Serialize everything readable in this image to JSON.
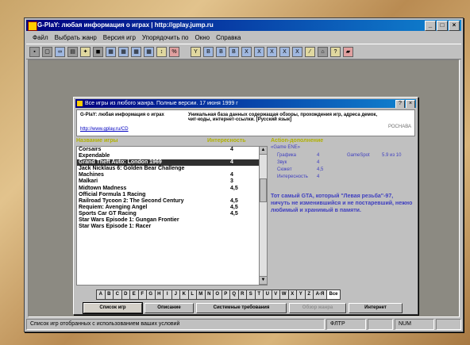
{
  "window": {
    "title": "G-PlaY: любая информация о играх | http://gplay.jump.ru",
    "controls": [
      "_",
      "□",
      "×"
    ]
  },
  "menu": [
    "Файл",
    "Выбрать жанр",
    "Версия игр",
    "Упорядочить по",
    "Окно",
    "Справка"
  ],
  "toolbar_icons": [
    "new-icon",
    "open-icon",
    "binoculars-icon",
    "print-icon",
    "tools-icon",
    "disk-icon",
    "grid-icon",
    "grid-icon",
    "grid-icon",
    "grid-icon",
    "sort-az-icon",
    "sort-icon",
    "filter-icon",
    "filter-icon",
    "filter-icon",
    "filter-icon",
    "filter-icon",
    "filter-icon",
    "filter-icon",
    "filter-icon",
    "filter-icon",
    "chart-icon",
    "home-icon",
    "help-icon",
    "book-icon"
  ],
  "dialog": {
    "title": "Все игры из любого жанра. Полные версии. 17 июня 1999 г",
    "controls": [
      "?",
      "×"
    ],
    "header_left": "G-PlaY: любая информация о играх",
    "header_right": "Уникальная база данных содержащая обзоры, прохождения игр, адреса демок, чит-коды, интернет-ссылки. [Русский язык]",
    "header_link": "http://www.gplay.ru/CD",
    "header_note": "РОСНАВА",
    "list_header_name": "Название игры",
    "list_header_rating": "Интересность",
    "games": [
      {
        "name": "Corsairs",
        "rating": "4"
      },
      {
        "name": "Expendable",
        "rating": ""
      },
      {
        "name": "Grand Theft Auto: London 1969",
        "rating": "4",
        "selected": true
      },
      {
        "name": "Jack Nicklaus 6: Golden Bear Challenge",
        "rating": ""
      },
      {
        "name": "Machines",
        "rating": "4"
      },
      {
        "name": "Malkari",
        "rating": "3"
      },
      {
        "name": "Midtown Madness",
        "rating": "4,5"
      },
      {
        "name": "Official Formula 1 Racing",
        "rating": ""
      },
      {
        "name": "Railroad Tycoon 2: The Second Century",
        "rating": "4,5"
      },
      {
        "name": "Requiem: Avenging Angel",
        "rating": "4,5"
      },
      {
        "name": "Sports Car GT Racing",
        "rating": "4,5"
      },
      {
        "name": "Star Wars Episode 1: Gungan Frontier",
        "rating": ""
      },
      {
        "name": "Star Wars Episode 1: Racer",
        "rating": ""
      }
    ],
    "info_header": "Action-дополнение",
    "info_sub": "«Game ENE»",
    "stats": {
      "graphics_label": "Графика",
      "graphics_value": "4",
      "sound_label": "Звук",
      "sound_value": "4",
      "plot_label": "Сюжет",
      "plot_value": "4,5",
      "interest_label": "Интересность",
      "interest_value": "4",
      "gamespot_label": "GameSpot",
      "gamespot_value": "5.9 из 10"
    },
    "description": "Тот самый GTA, который \"Левая резьба\"-97, ничуть не изменившийся и не постаревший, нежно любимый и хранимый в памяти.",
    "alphabet": [
      "A",
      "B",
      "C",
      "D",
      "E",
      "F",
      "G",
      "H",
      "I",
      "J",
      "K",
      "L",
      "M",
      "N",
      "O",
      "P",
      "Q",
      "R",
      "S",
      "T",
      "U",
      "V",
      "W",
      "X",
      "Y",
      "Z",
      "A-Я",
      "Все"
    ],
    "buttons": [
      "Список игр",
      "Описание",
      "Системные требования",
      "Обзор жанра",
      "Интернет"
    ]
  },
  "status": {
    "text": "Список игр отобранных с использованием ваших условий",
    "filter": "ФЛТР",
    "num": "NUM"
  }
}
